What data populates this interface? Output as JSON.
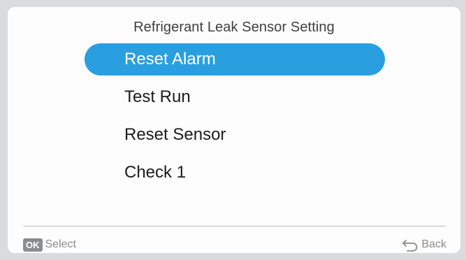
{
  "screen": {
    "title": "Refrigerant Leak Sensor Setting"
  },
  "menu": {
    "items": [
      {
        "label": "Reset Alarm",
        "selected": true
      },
      {
        "label": "Test Run",
        "selected": false
      },
      {
        "label": "Reset Sensor",
        "selected": false
      },
      {
        "label": "Check 1",
        "selected": false
      }
    ]
  },
  "footer": {
    "ok_badge": "OK",
    "select_label": "Select",
    "back_label": "Back",
    "back_icon": "back-arrow-icon"
  },
  "colors": {
    "selection": "#2a9fe0",
    "text": "#1c1c1c",
    "hint": "#8b8b8b"
  }
}
